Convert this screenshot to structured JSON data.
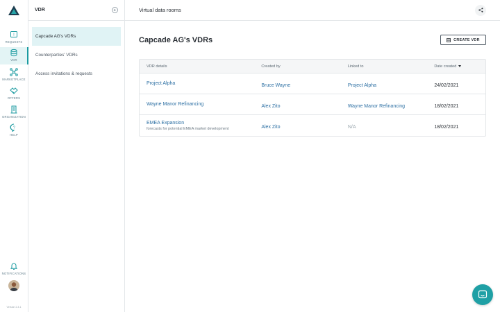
{
  "nav": {
    "requests": "REQUESTS",
    "vdr": "VDR",
    "marketplace": "MARKETPLACE",
    "offers": "OFFERS",
    "organization": "ORGANIZATION",
    "help": "HELP",
    "notifications": "NOTIFICATIONS",
    "version": "Version 2.4.1"
  },
  "subnav": {
    "title": "VDR",
    "items": [
      "Capcade AG's VDRs",
      "Counterparties' VDRs",
      "Access invitations & requests"
    ]
  },
  "topbar": {
    "title": "Virtual data rooms"
  },
  "main": {
    "page_title": "Capcade AG's VDRs",
    "create_label": "CREATE VDR",
    "columns": [
      "VDR details",
      "Created by",
      "Linked to",
      "Date created"
    ],
    "rows": [
      {
        "name": "Project Alpha",
        "desc": "",
        "created_by": "Bruce Wayne",
        "linked_to": "Project Alpha",
        "date": "24/02/2021"
      },
      {
        "name": "Wayne Manor Refinancing",
        "desc": "",
        "created_by": "Alex Zito",
        "linked_to": "Wayne Manor Refinancing",
        "date": "18/02/2021"
      },
      {
        "name": "EMEA Expansion",
        "desc": "forecasts for potential EMEA market development",
        "created_by": "Alex Zito",
        "linked_to": "N/A",
        "date": "18/02/2021"
      }
    ]
  },
  "colors": {
    "accent": "#1a9aa0",
    "link": "#2c6fa3",
    "chat": "#1fa0a5"
  }
}
